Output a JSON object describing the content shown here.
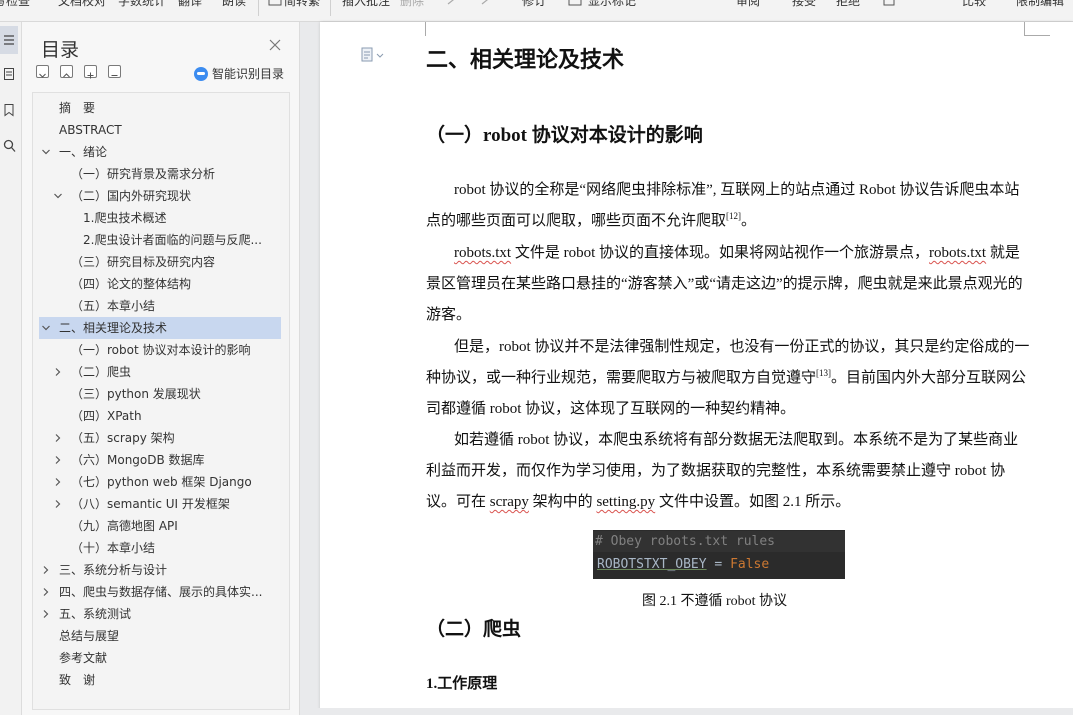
{
  "ribbon": {
    "items": [
      "文档校对",
      "字数统计",
      "翻译",
      "朗读",
      "插入批注",
      "删除",
      "修订",
      "显示标记",
      "审阅",
      "接受",
      "拒绝",
      "比较",
      "限制编辑"
    ],
    "clipped_left": "拼写检查",
    "clipped_convert": "简转繁"
  },
  "toc": {
    "title": "目录",
    "smart_label": "智能识别目录",
    "items": [
      {
        "label": "摘　要",
        "level": 0,
        "chevron": "none"
      },
      {
        "label": "ABSTRACT",
        "level": 0,
        "chevron": "none"
      },
      {
        "label": "一、绪论",
        "level": 0,
        "chevron": "down"
      },
      {
        "label": "（一）研究背景及需求分析",
        "level": 1,
        "chevron": "none"
      },
      {
        "label": "（二）国内外研究现状",
        "level": 1,
        "chevron": "down"
      },
      {
        "label": "1.爬虫技术概述",
        "level": 2,
        "chevron": "none"
      },
      {
        "label": "2.爬虫设计者面临的问题与反爬...",
        "level": 2,
        "chevron": "none"
      },
      {
        "label": "（三）研究目标及研究内容",
        "level": 1,
        "chevron": "none"
      },
      {
        "label": "（四）论文的整体结构",
        "level": 1,
        "chevron": "none"
      },
      {
        "label": "（五）本章小结",
        "level": 1,
        "chevron": "none"
      },
      {
        "label": "二、相关理论及技术",
        "level": 0,
        "chevron": "down",
        "selected": true
      },
      {
        "label": "（一）robot 协议对本设计的影响",
        "level": 1,
        "chevron": "none"
      },
      {
        "label": "（二）爬虫",
        "level": 1,
        "chevron": "right"
      },
      {
        "label": "（三）python 发展现状",
        "level": 1,
        "chevron": "none"
      },
      {
        "label": "（四）XPath",
        "level": 1,
        "chevron": "none"
      },
      {
        "label": "（五）scrapy 架构",
        "level": 1,
        "chevron": "right"
      },
      {
        "label": "（六）MongoDB 数据库",
        "level": 1,
        "chevron": "right"
      },
      {
        "label": "（七）python web 框架 Django",
        "level": 1,
        "chevron": "right"
      },
      {
        "label": "（八）semantic UI 开发框架",
        "level": 1,
        "chevron": "right"
      },
      {
        "label": "（九）高德地图 API",
        "level": 1,
        "chevron": "none"
      },
      {
        "label": "（十）本章小结",
        "level": 1,
        "chevron": "none"
      },
      {
        "label": "三、系统分析与设计",
        "level": 0,
        "chevron": "right"
      },
      {
        "label": "四、爬虫与数据存储、展示的具体实...",
        "level": 0,
        "chevron": "right"
      },
      {
        "label": "五、系统测试",
        "level": 0,
        "chevron": "right"
      },
      {
        "label": "总结与展望",
        "level": 0,
        "chevron": "none"
      },
      {
        "label": "参考文献",
        "level": 0,
        "chevron": "none"
      },
      {
        "label": "致　谢",
        "level": 0,
        "chevron": "none"
      }
    ]
  },
  "document": {
    "h1": "二、相关理论及技术",
    "h2a": "（一）robot 协议对本设计的影响",
    "p1a": "robot 协议的全称是“网络爬虫排除标准”, 互联网上的站点通过 Robot 协议告诉爬虫本站点的哪些页面可以爬取，哪些页面不允许爬取",
    "p1_ref": "[12]",
    "p1b": "。",
    "p2_word": "robots.txt",
    "p2a": " 文件是 robot 协议的直接体现。如果将网站视作一个旅游景点，",
    "p2_word2": "robots.txt",
    "p2b": " 就是景区管理员在某些路口悬挂的“游客禁入”或“请走这边”的提示牌，爬虫就是来此景点观光的游客。",
    "p3a": "但是，robot 协议并不是法律强制性规定，也没有一份正式的协议，其只是约定俗成的一种协议，或一种行业规范，需要爬取方与被爬取方自觉遵守",
    "p3_ref": "[13]",
    "p3b": "。目前国内外大部分互联网公司都遵循 robot 协议，这体现了互联网的一种契约精神。",
    "p4a": "如若遵循 robot 协议，本爬虫系统将有部分数据无法爬取到。本系统不是为了某些商业利益而开发，而仅作为学习使用，为了数据获取的完整性，本系统需要禁止遵守 robot 协议。可在 ",
    "p4_w1": "scrapy",
    "p4b": " 架构中的 ",
    "p4_w2": "setting.py",
    "p4c": " 文件中设置。如图 2.1 所示。",
    "code_line1": "# Obey robots.txt rules",
    "code_ident": "ROBOTSTXT_OBEY",
    "code_eq": " = ",
    "code_val": "False",
    "fig_caption": "图 2.1  不遵循 robot 协议",
    "h2b": "（二）爬虫",
    "h3": "1.工作原理"
  },
  "colors": {
    "accent": "#3c8cf0",
    "selected_row": "#c8d7ef",
    "code_bg": "#2b2b2b",
    "code_keyword": "#cc7832"
  }
}
